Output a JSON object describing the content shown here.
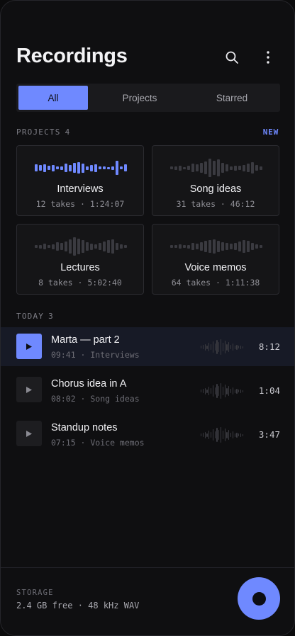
{
  "header": {
    "title": "Recordings",
    "search_icon": "search-icon",
    "more_icon": "more-vertical-icon"
  },
  "tabs": [
    {
      "label": "All",
      "active": true
    },
    {
      "label": "Projects",
      "active": false
    },
    {
      "label": "Starred",
      "active": false
    }
  ],
  "projects": {
    "section_label": "PROJECTS",
    "count": "4",
    "new_label": "NEW",
    "items": [
      {
        "name": "Interviews",
        "meta": "12 takes · 1:24:07",
        "highlighted": true
      },
      {
        "name": "Song ideas",
        "meta": "31 takes · 46:12",
        "highlighted": false
      },
      {
        "name": "Lectures",
        "meta": "8 takes · 5:02:40",
        "highlighted": false
      },
      {
        "name": "Voice memos",
        "meta": "64 takes · 1:11:38",
        "highlighted": false
      }
    ]
  },
  "today": {
    "section_label": "TODAY",
    "count": "3",
    "items": [
      {
        "name": "Marta — part 2",
        "meta": "09:41 · Interviews",
        "duration": "8:12",
        "active": true
      },
      {
        "name": "Chorus idea in A",
        "meta": "08:02 · Song ideas",
        "duration": "1:04",
        "active": false
      },
      {
        "name": "Standup notes",
        "meta": "07:15 · Voice memos",
        "duration": "3:47",
        "active": false
      }
    ]
  },
  "footer": {
    "storage_label": "STORAGE",
    "storage_info": "2.4 GB free · 48 kHz WAV",
    "record_icon": "record-icon"
  },
  "colors": {
    "accent": "#6f89ff",
    "background": "#0f0f11",
    "card": "#151517"
  }
}
